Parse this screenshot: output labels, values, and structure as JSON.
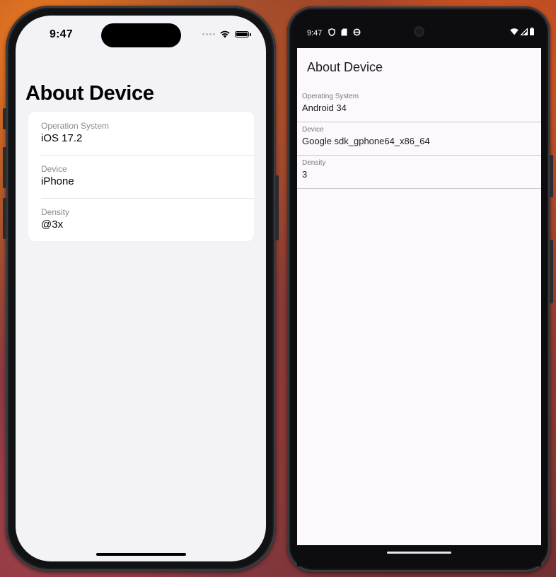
{
  "ios": {
    "status_time": "9:47",
    "title": "About Device",
    "rows": [
      {
        "label": "Operation System",
        "value": "iOS 17.2"
      },
      {
        "label": "Device",
        "value": "iPhone"
      },
      {
        "label": "Density",
        "value": "@3x"
      }
    ],
    "icons": [
      "signal-dots-icon",
      "wifi-icon",
      "battery-icon"
    ]
  },
  "android": {
    "status_time": "9:47",
    "title": "About Device",
    "rows": [
      {
        "label": "Operating System",
        "value": "Android 34"
      },
      {
        "label": "Device",
        "value": "Google sdk_gphone64_x86_64"
      },
      {
        "label": "Density",
        "value": "3"
      }
    ],
    "icons": [
      "shield-icon",
      "sd-card-icon",
      "sync-icon",
      "wifi-icon",
      "cell-signal-icon",
      "battery-icon"
    ]
  }
}
